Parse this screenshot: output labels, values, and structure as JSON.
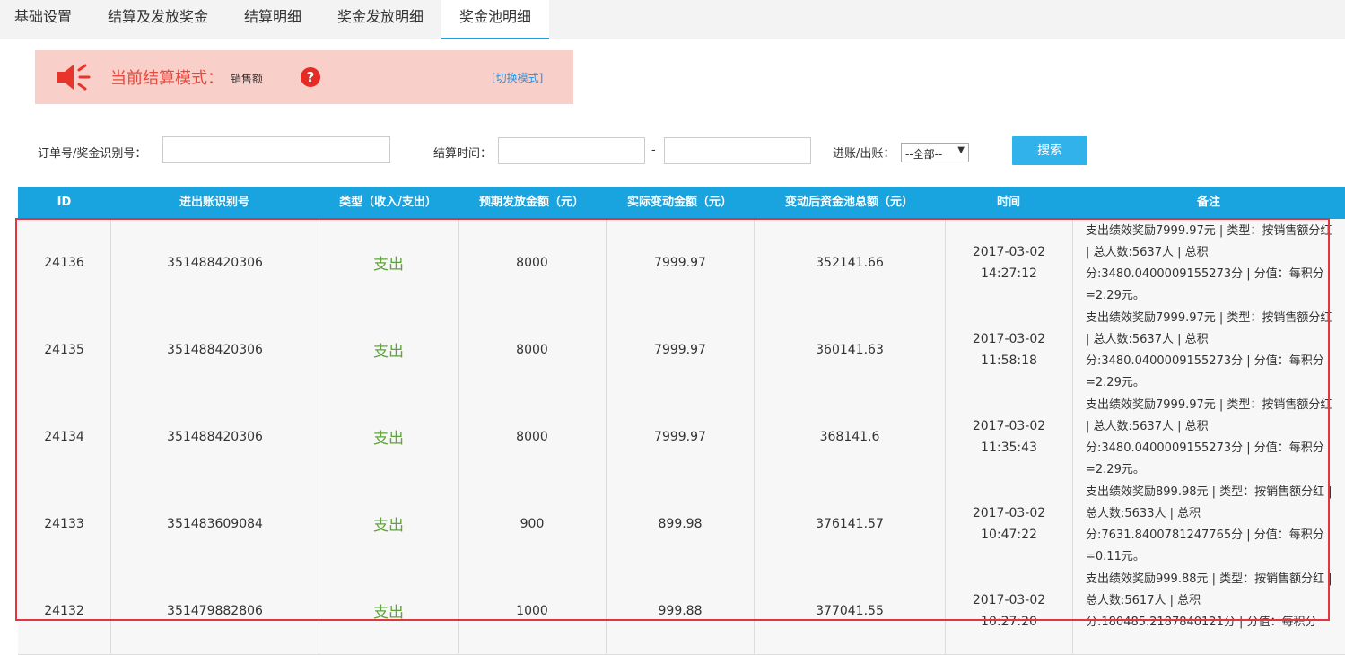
{
  "tabs": [
    {
      "label": "基础设置"
    },
    {
      "label": "结算及发放奖金"
    },
    {
      "label": "结算明细"
    },
    {
      "label": "奖金发放明细"
    },
    {
      "label": "奖金池明细"
    }
  ],
  "active_tab": "奖金池明细",
  "notice": {
    "icon": "speaker-icon",
    "title": "当前结算模式：",
    "mode": "销售额",
    "help_icon": "question-icon",
    "help_glyph": "?",
    "switch_link": "[切换模式]"
  },
  "search": {
    "order_label": "订单号/奖金识别号：",
    "order_value": "",
    "time_label": "结算时间：",
    "time_start": "",
    "time_sep": "-",
    "time_end": "",
    "inout_label": "进账/出账：",
    "inout_selected": "--全部--",
    "submit_label": "搜索"
  },
  "table": {
    "headers": [
      "ID",
      "进出账识别号",
      "类型（收入/支出）",
      "预期发放金额（元）",
      "实际变动金额（元）",
      "变动后资金池总额（元）",
      "时间",
      "备注"
    ],
    "rows": [
      {
        "id": "24136",
        "code": "351488420306",
        "type": "支出",
        "expected": "8000",
        "actual": "7999.97",
        "pool": "352141.66",
        "date": "2017-03-02",
        "time": "14:27:12",
        "remark": "支出绩效奖励7999.97元 | 类型：按销售额分红 | 总人数:5637人 | 总积分:3480.0400009155273分 | 分值：每积分=2.29元。"
      },
      {
        "id": "24135",
        "code": "351488420306",
        "type": "支出",
        "expected": "8000",
        "actual": "7999.97",
        "pool": "360141.63",
        "date": "2017-03-02",
        "time": "11:58:18",
        "remark": "支出绩效奖励7999.97元 | 类型：按销售额分红 | 总人数:5637人 | 总积分:3480.0400009155273分 | 分值：每积分=2.29元。"
      },
      {
        "id": "24134",
        "code": "351488420306",
        "type": "支出",
        "expected": "8000",
        "actual": "7999.97",
        "pool": "368141.6",
        "date": "2017-03-02",
        "time": "11:35:43",
        "remark": "支出绩效奖励7999.97元 | 类型：按销售额分红 | 总人数:5637人 | 总积分:3480.0400009155273分 | 分值：每积分=2.29元。"
      },
      {
        "id": "24133",
        "code": "351483609084",
        "type": "支出",
        "expected": "900",
        "actual": "899.98",
        "pool": "376141.57",
        "date": "2017-03-02",
        "time": "10:47:22",
        "remark": "支出绩效奖励899.98元 | 类型：按销售额分红 | 总人数:5633人 | 总积分:7631.8400781247765分 | 分值：每积分=0.11元。"
      },
      {
        "id": "24132",
        "code": "351479882806",
        "type": "支出",
        "expected": "1000",
        "actual": "999.88",
        "pool": "377041.55",
        "date": "2017-03-02",
        "time": "10:27:20",
        "remark": "支出绩效奖励999.88元 | 类型：按销售额分红 | 总人数:5617人 | 总积分:180485.2187840121分 | 分值：每积分"
      }
    ]
  },
  "colors": {
    "header_bg": "#19a3df",
    "notice_bg": "#f9cfc9",
    "accent_red": "#e64a3e",
    "type_green": "#5fa43b",
    "button_bg": "#32b2ea",
    "highlight_border": "#e4343d"
  }
}
